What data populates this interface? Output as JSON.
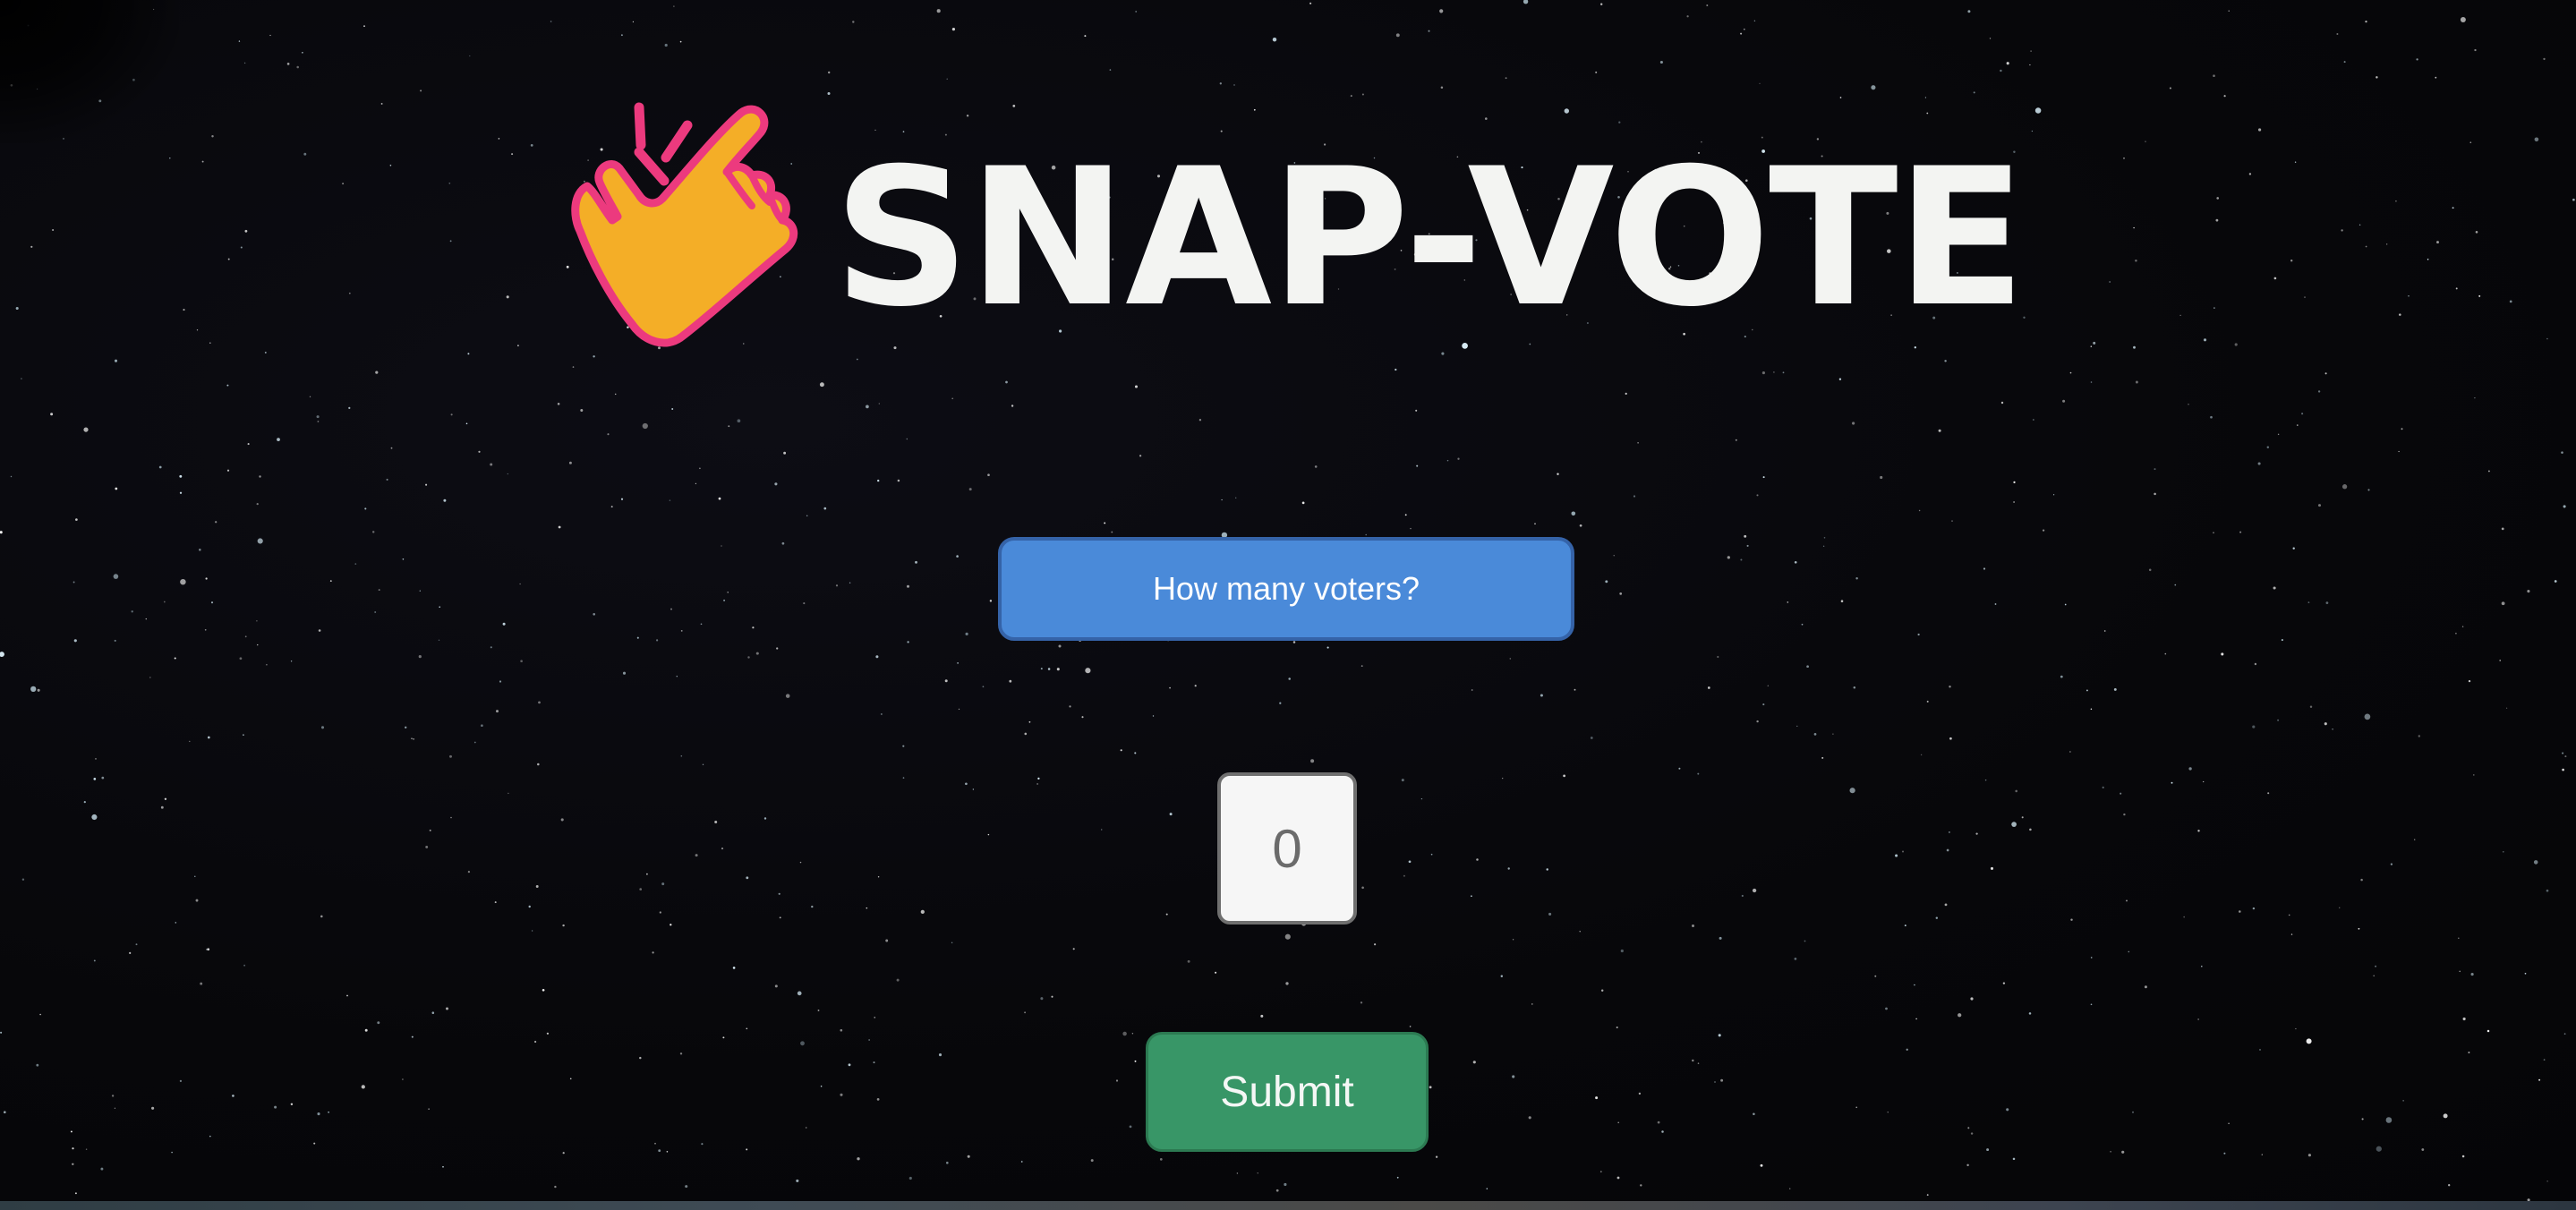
{
  "app": {
    "title": "SNAP-VOTE",
    "logo_icon": "snapping-hand-icon"
  },
  "form": {
    "question_label": "How many voters?",
    "voters_value": "0",
    "submit_label": "Submit"
  },
  "colors": {
    "background": "#08080b",
    "question_button": "#4a8ad9",
    "submit_button": "#389667",
    "hand_fill": "#f4ae27",
    "hand_outline": "#ec3a7e",
    "title_text": "#f3f4f2"
  }
}
